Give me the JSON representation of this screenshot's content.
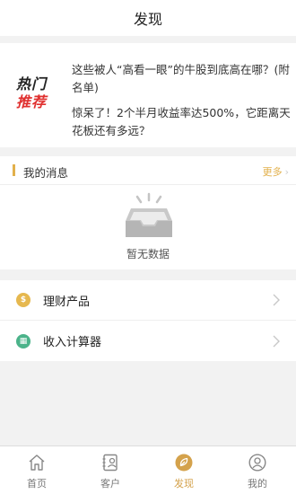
{
  "header": {
    "title": "发现"
  },
  "hot": {
    "logo_line1": "热门",
    "logo_line2": "推荐",
    "items": [
      {
        "text": "这些被人“高看一眼”的牛股到底高在哪？(附名单)"
      },
      {
        "text": "惊呆了！2个半月收益率达500%，它距离天花板还有多远？"
      }
    ]
  },
  "messages": {
    "title": "我的消息",
    "more_label": "更多",
    "empty_text": "暂无数据"
  },
  "menu": {
    "items": [
      {
        "label": "理财产品",
        "icon": "coin-icon",
        "icon_glyph": "$",
        "color": "#e6b84f"
      },
      {
        "label": "收入计算器",
        "icon": "calculator-icon",
        "icon_glyph": "▦",
        "color": "#4bb38a"
      }
    ]
  },
  "tabbar": {
    "tabs": [
      {
        "label": "首页",
        "icon": "home-icon",
        "active": false
      },
      {
        "label": "客户",
        "icon": "customer-icon",
        "active": false
      },
      {
        "label": "发现",
        "icon": "discover-icon",
        "active": true
      },
      {
        "label": "我的",
        "icon": "profile-icon",
        "active": false
      }
    ]
  },
  "colors": {
    "accent": "#d4a24c",
    "hot_red": "#e0302f",
    "background": "#f2f2f2"
  }
}
